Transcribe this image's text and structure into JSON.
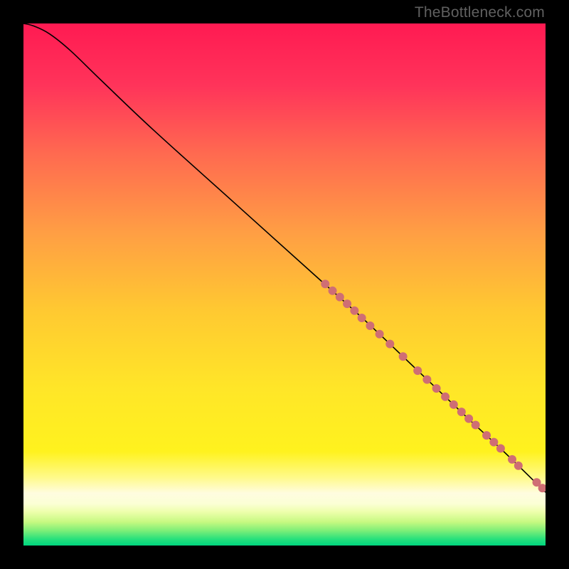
{
  "watermark": "TheBottleneck.com",
  "chart_data": {
    "type": "line",
    "title": "",
    "xlabel": "",
    "ylabel": "",
    "xlim": [
      0,
      100
    ],
    "ylim": [
      0,
      100
    ],
    "gradient_stops": [
      {
        "offset": 0.0,
        "color": "#ff1a52"
      },
      {
        "offset": 0.12,
        "color": "#ff345a"
      },
      {
        "offset": 0.25,
        "color": "#ff6a50"
      },
      {
        "offset": 0.4,
        "color": "#ff9e44"
      },
      {
        "offset": 0.55,
        "color": "#ffc931"
      },
      {
        "offset": 0.7,
        "color": "#ffe628"
      },
      {
        "offset": 0.82,
        "color": "#fff21e"
      },
      {
        "offset": 0.87,
        "color": "#fffa8b"
      },
      {
        "offset": 0.9,
        "color": "#fffce0"
      },
      {
        "offset": 0.92,
        "color": "#fbffd5"
      },
      {
        "offset": 0.935,
        "color": "#eeffad"
      },
      {
        "offset": 0.955,
        "color": "#c6f981"
      },
      {
        "offset": 0.972,
        "color": "#7aee78"
      },
      {
        "offset": 0.988,
        "color": "#26e07c"
      },
      {
        "offset": 1.0,
        "color": "#00d67e"
      }
    ],
    "curve": [
      {
        "x": 0.0,
        "y": 100.0
      },
      {
        "x": 2.0,
        "y": 99.5
      },
      {
        "x": 5.0,
        "y": 98.0
      },
      {
        "x": 9.0,
        "y": 94.8
      },
      {
        "x": 15.0,
        "y": 89.0
      },
      {
        "x": 25.0,
        "y": 79.5
      },
      {
        "x": 40.0,
        "y": 66.0
      },
      {
        "x": 55.0,
        "y": 52.5
      },
      {
        "x": 65.0,
        "y": 43.5
      },
      {
        "x": 75.0,
        "y": 34.0
      },
      {
        "x": 85.0,
        "y": 24.5
      },
      {
        "x": 92.0,
        "y": 18.0
      },
      {
        "x": 100.0,
        "y": 10.2
      }
    ],
    "highlight_dots": [
      {
        "x": 57.8,
        "y": 50.1
      },
      {
        "x": 59.2,
        "y": 48.8
      },
      {
        "x": 60.6,
        "y": 47.6
      },
      {
        "x": 62.0,
        "y": 46.3
      },
      {
        "x": 63.4,
        "y": 45.0
      },
      {
        "x": 64.8,
        "y": 43.6
      },
      {
        "x": 66.4,
        "y": 42.1
      },
      {
        "x": 68.2,
        "y": 40.5
      },
      {
        "x": 70.2,
        "y": 38.6
      },
      {
        "x": 72.7,
        "y": 36.2
      },
      {
        "x": 75.5,
        "y": 33.5
      },
      {
        "x": 77.3,
        "y": 31.8
      },
      {
        "x": 79.1,
        "y": 30.1
      },
      {
        "x": 80.8,
        "y": 28.5
      },
      {
        "x": 82.4,
        "y": 27.0
      },
      {
        "x": 83.9,
        "y": 25.6
      },
      {
        "x": 85.3,
        "y": 24.3
      },
      {
        "x": 86.6,
        "y": 23.1
      },
      {
        "x": 88.7,
        "y": 21.1
      },
      {
        "x": 90.1,
        "y": 19.8
      },
      {
        "x": 91.4,
        "y": 18.6
      },
      {
        "x": 93.6,
        "y": 16.5
      },
      {
        "x": 94.8,
        "y": 15.3
      },
      {
        "x": 98.3,
        "y": 12.1
      },
      {
        "x": 99.4,
        "y": 11.0
      }
    ],
    "dot_color": "#cf6e74",
    "dot_radius": 6,
    "curve_color": "#000000",
    "curve_width": 1.6
  }
}
